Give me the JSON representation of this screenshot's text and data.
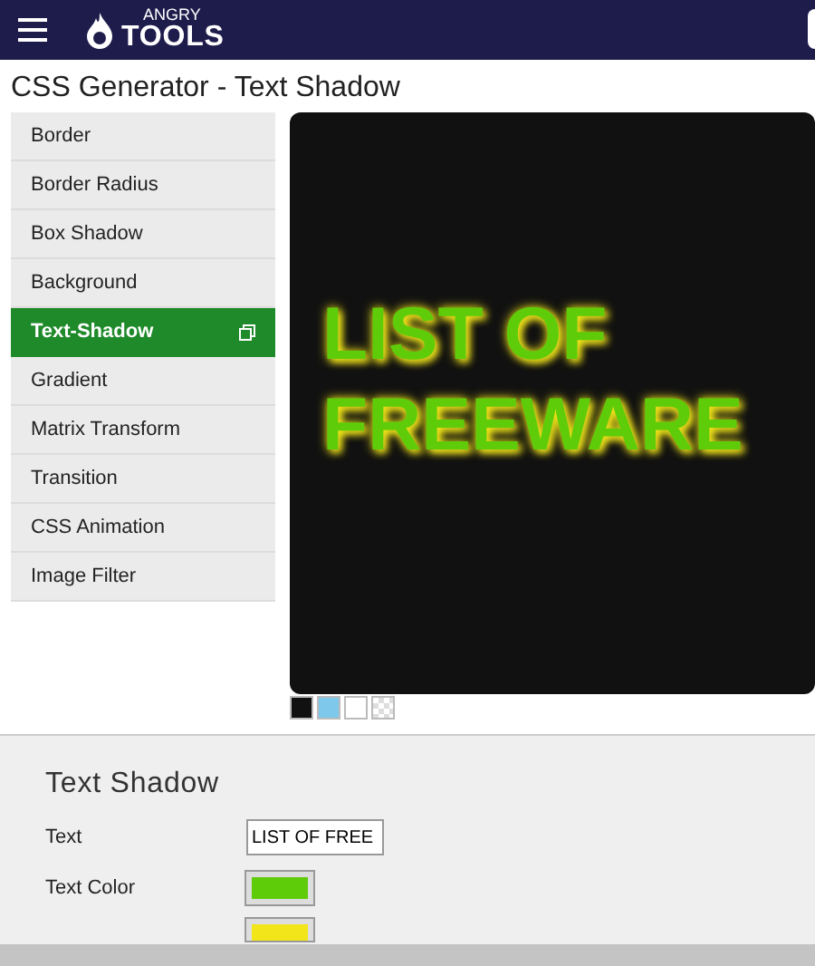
{
  "header": {
    "logo_top": "ANGRY",
    "logo_bottom": "TOOLS"
  },
  "page_title": "CSS Generator - Text Shadow",
  "sidebar": {
    "items": [
      {
        "label": "Border",
        "selected": false
      },
      {
        "label": "Border Radius",
        "selected": false
      },
      {
        "label": "Box Shadow",
        "selected": false
      },
      {
        "label": "Background",
        "selected": false
      },
      {
        "label": "Text-Shadow",
        "selected": true
      },
      {
        "label": "Gradient",
        "selected": false
      },
      {
        "label": "Matrix Transform",
        "selected": false
      },
      {
        "label": "Transition",
        "selected": false
      },
      {
        "label": "CSS Animation",
        "selected": false
      },
      {
        "label": "Image Filter",
        "selected": false
      }
    ]
  },
  "preview": {
    "lines": [
      "LIST OF",
      "FREEWARE"
    ]
  },
  "backgrounds": [
    {
      "kind": "solid",
      "color": "#111111"
    },
    {
      "kind": "solid",
      "color": "#7ec8ec"
    },
    {
      "kind": "solid",
      "color": "#ffffff"
    },
    {
      "kind": "transparent"
    }
  ],
  "form": {
    "title": "Text Shadow",
    "rows": [
      {
        "kind": "text",
        "label": "Text",
        "value": "LIST OF FREE"
      },
      {
        "kind": "color",
        "label": "Text Color",
        "color": "#5fcc0a"
      },
      {
        "kind": "color",
        "color": "#f2e61a"
      }
    ]
  }
}
